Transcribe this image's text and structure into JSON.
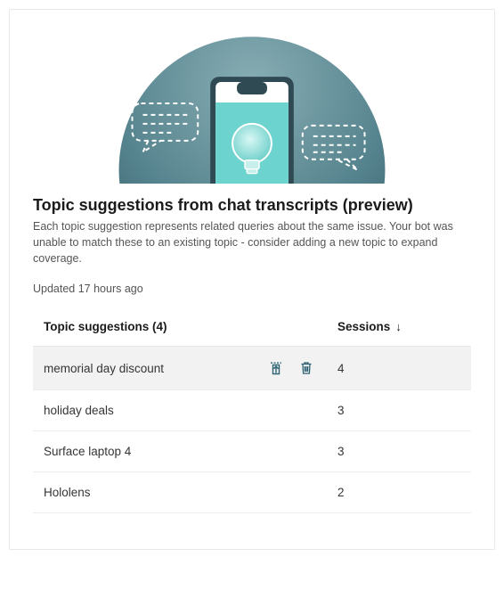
{
  "header": {
    "title": "Topic suggestions from chat transcripts (preview)",
    "description": "Each topic suggestion represents related queries about the same issue. Your bot was unable to match these to an existing topic - consider adding a new topic to expand coverage.",
    "updated": "Updated 17 hours ago"
  },
  "table": {
    "headers": {
      "topic": "Topic suggestions (4)",
      "sessions": "Sessions"
    },
    "sort_indicator": "↓",
    "rows": [
      {
        "topic": "memorial day discount",
        "sessions": "4",
        "hovered": true
      },
      {
        "topic": "holiday deals",
        "sessions": "3",
        "hovered": false
      },
      {
        "topic": "Surface laptop 4",
        "sessions": "3",
        "hovered": false
      },
      {
        "topic": "Hololens",
        "sessions": "2",
        "hovered": false
      }
    ]
  },
  "icons": {
    "add": "add-to-topics-icon",
    "delete": "delete-icon"
  },
  "colors": {
    "accent": "#2b6173",
    "hero_bg_dark": "#3e6b76",
    "hero_bg_light": "#91b2b9",
    "phone_body": "#5fcfca"
  }
}
